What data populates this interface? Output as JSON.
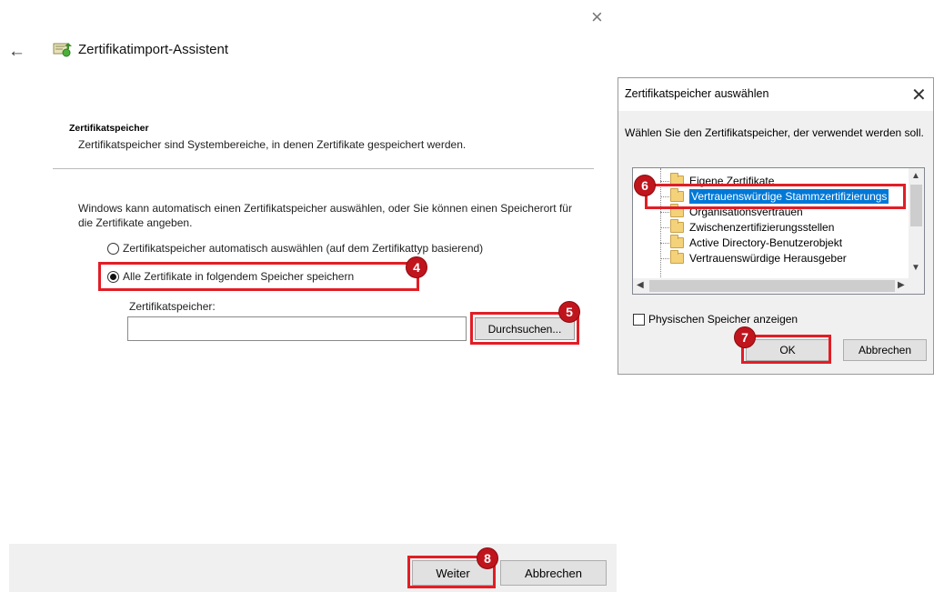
{
  "wizard": {
    "title": "Zertifikatimport-Assistent",
    "close_glyph": "×",
    "back_glyph": "←",
    "section_heading": "Zertifikatspeicher",
    "section_description": "Zertifikatspeicher sind Systembereiche, in denen Zertifikate gespeichert werden.",
    "intro_text": "Windows kann automatisch einen Zertifikatspeicher auswählen, oder Sie können einen Speicherort für die Zertifikate angeben.",
    "radio_auto_label": "Zertifikatspeicher automatisch auswählen (auf dem Zertifikattyp basierend)",
    "radio_manual_label": "Alle Zertifikate in folgendem Speicher speichern",
    "selected_option": "manual",
    "store_label": "Zertifikatspeicher:",
    "store_value": "",
    "browse_label": "Durchsuchen...",
    "next_label": "Weiter",
    "cancel_label": "Abbrechen"
  },
  "store_dialog": {
    "title": "Zertifikatspeicher auswählen",
    "close_glyph": "✕",
    "instruction": "Wählen Sie den Zertifikatspeicher, der verwendet werden soll.",
    "stores": [
      {
        "label": "Eigene Zertifikate"
      },
      {
        "label": "Vertrauenswürdige Stammzertifizierungs"
      },
      {
        "label": "Organisationsvertrauen"
      },
      {
        "label": "Zwischenzertifizierungsstellen"
      },
      {
        "label": "Active Directory-Benutzerobjekt"
      },
      {
        "label": "Vertrauenswürdige Herausgeber"
      }
    ],
    "selected_store": "Vertrauenswürdige Stammzertifizierungs",
    "physical_store_label": "Physischen Speicher anzeigen",
    "physical_store_checked": false,
    "ok_label": "OK",
    "cancel_label": "Abbrechen"
  },
  "annotations": {
    "step_4": "4",
    "step_5": "5",
    "step_6": "6",
    "step_7": "7",
    "step_8": "8",
    "highlight_color": "#e21d25"
  },
  "icons": {
    "wizard": "certificate-wizard-icon",
    "folder": "folder-icon"
  },
  "colors": {
    "selection": "#0078d7",
    "footer": "#f0f0f0",
    "badge": "#c0151d"
  }
}
